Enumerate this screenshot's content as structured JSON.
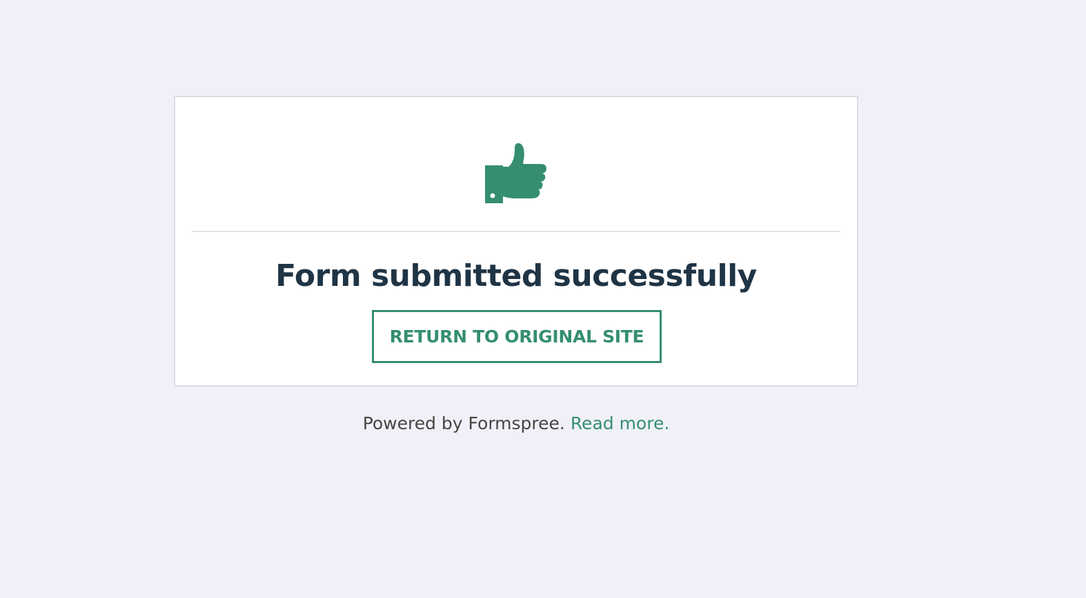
{
  "colors": {
    "background": "#f0f1f8",
    "accent": "#358e71",
    "title": "#1f3445"
  },
  "card": {
    "icon": "thumbs-up-icon",
    "title": "Form submitted successfully",
    "return_button_label": "RETURN TO ORIGINAL SITE"
  },
  "footer": {
    "powered_text": "Powered by Formspree.",
    "read_more_label": "Read more."
  }
}
